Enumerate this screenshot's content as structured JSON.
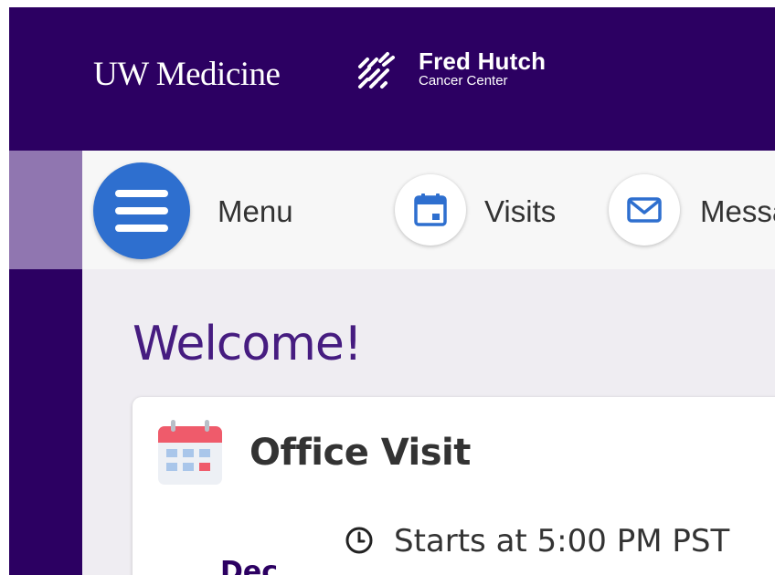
{
  "header": {
    "uw_logo_text": "UW Medicine",
    "fred_hutch_title": "Fred Hutch",
    "fred_hutch_subtitle": "Cancer Center"
  },
  "nav": {
    "items": [
      {
        "label": "Menu",
        "icon": "hamburger-icon"
      },
      {
        "label": "Visits",
        "icon": "calendar-icon"
      },
      {
        "label": "Messa",
        "icon": "envelope-icon"
      }
    ]
  },
  "main": {
    "welcome": "Welcome!",
    "card": {
      "title": "Office Visit",
      "time": "Starts at 5:00 PM PST",
      "month": "Dec",
      "icon": "calendar-icon"
    }
  },
  "colors": {
    "brand_purple": "#2c0062",
    "accent_blue": "#2e6fcf",
    "welcome_purple": "#461c80"
  }
}
